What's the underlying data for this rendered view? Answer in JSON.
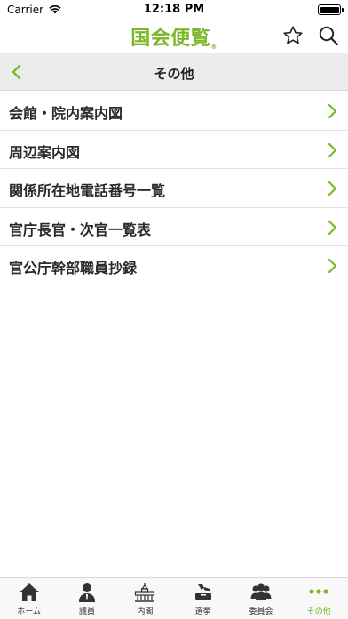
{
  "status_bar": {
    "carrier": "Carrier",
    "time": "12:18 PM"
  },
  "header": {
    "title": "国会便覧",
    "title_mark": "®",
    "accent_color": "#7ab829"
  },
  "subheader": {
    "title": "その他"
  },
  "menu": {
    "items": [
      {
        "label": "会館・院内案内図"
      },
      {
        "label": "周辺案内図"
      },
      {
        "label": "関係所在地電話番号一覧"
      },
      {
        "label": "官庁長官・次官一覧表"
      },
      {
        "label": "官公庁幹部職員抄録"
      }
    ]
  },
  "tab_bar": {
    "active_index": 5,
    "tabs": [
      {
        "label": "ホーム",
        "icon": "home-icon"
      },
      {
        "label": "議員",
        "icon": "person-icon"
      },
      {
        "label": "内閣",
        "icon": "diet-building-icon"
      },
      {
        "label": "選挙",
        "icon": "ballot-box-icon"
      },
      {
        "label": "委員会",
        "icon": "group-icon"
      },
      {
        "label": "その他",
        "icon": "more-dots-icon"
      }
    ]
  }
}
